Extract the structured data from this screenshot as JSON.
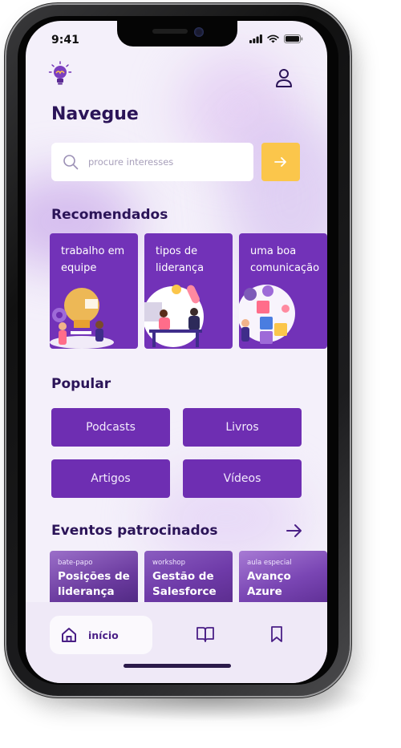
{
  "status_bar": {
    "time": "9:41"
  },
  "page": {
    "title": "Navegue"
  },
  "search": {
    "placeholder": "procure interesses"
  },
  "recommended": {
    "heading": "Recomendados",
    "cards": [
      {
        "label": "trabalho em equipe"
      },
      {
        "label": "tipos de liderança"
      },
      {
        "label": "uma boa comunicação"
      }
    ]
  },
  "popular": {
    "heading": "Popular",
    "items": [
      {
        "label": "Podcasts"
      },
      {
        "label": "Livros"
      },
      {
        "label": "Artigos"
      },
      {
        "label": "Vídeos"
      }
    ]
  },
  "events": {
    "heading": "Eventos patrocinados",
    "items": [
      {
        "tag": "bate-papo",
        "title": "Posições de liderança"
      },
      {
        "tag": "workshop",
        "title": "Gestão de Salesforce"
      },
      {
        "tag": "aula especial",
        "title": "Avanço Azure"
      }
    ]
  },
  "bottom_nav": {
    "home_label": "início"
  },
  "colors": {
    "primary": "#6e2eb2",
    "accent": "#fbc64b",
    "heading": "#2b1458",
    "background": "#f4f0fa"
  },
  "icons": [
    "lightbulb-logo-icon",
    "profile-icon",
    "search-icon",
    "arrow-right-icon",
    "home-icon",
    "book-icon",
    "bookmark-icon"
  ]
}
